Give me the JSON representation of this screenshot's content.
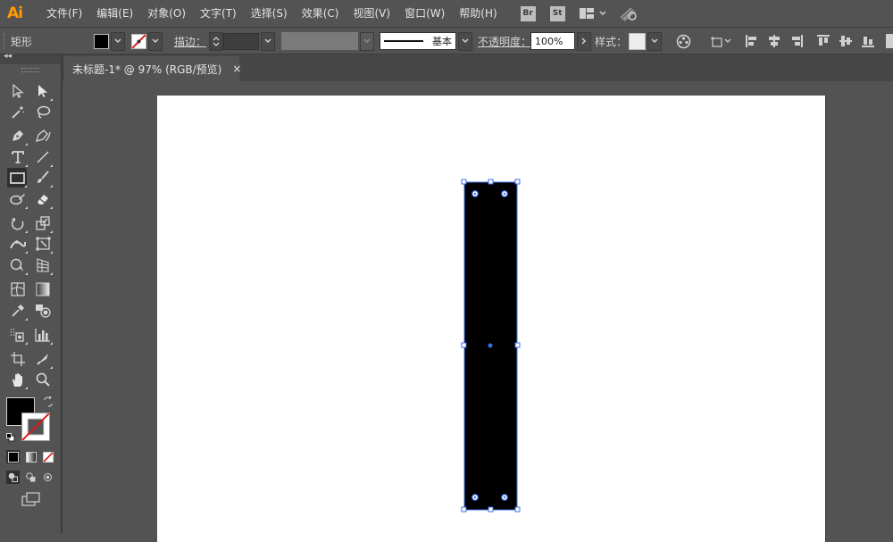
{
  "app": {
    "logo": "Ai"
  },
  "menu": [
    "文件(F)",
    "编辑(E)",
    "对象(O)",
    "文字(T)",
    "选择(S)",
    "效果(C)",
    "视图(V)",
    "窗口(W)",
    "帮助(H)"
  ],
  "app_badges": [
    "Br",
    "St"
  ],
  "control_bar": {
    "tool_name": "矩形",
    "stroke_label": "描边：",
    "brush_label": "基本",
    "opacity_label": "不透明度：",
    "opacity_value": "100%",
    "style_label": "样式："
  },
  "document_tab": {
    "title": "未标题-1* @ 97% (RGB/预览)",
    "close": "×"
  },
  "colors": {
    "accent": "#ff9a00",
    "ui_bg": "#535353",
    "selection": "#3b6fe8",
    "fill": "#000000",
    "stroke_none": "#e01818"
  },
  "tools": [
    "selection-tool",
    "direct-selection-tool",
    "magic-wand-tool",
    "lasso-tool",
    "pen-tool",
    "curvature-tool",
    "type-tool",
    "line-segment-tool",
    "rectangle-tool",
    "paintbrush-tool",
    "shaper-tool",
    "eraser-tool",
    "rotate-tool",
    "scale-tool",
    "width-tool",
    "free-transform-tool",
    "shape-builder-tool",
    "perspective-grid-tool",
    "mesh-tool",
    "gradient-tool",
    "eyedropper-tool",
    "blend-tool",
    "symbol-sprayer-tool",
    "column-graph-tool",
    "artboard-tool",
    "slice-tool",
    "hand-tool",
    "zoom-tool"
  ],
  "selected_tool": "rectangle-tool"
}
